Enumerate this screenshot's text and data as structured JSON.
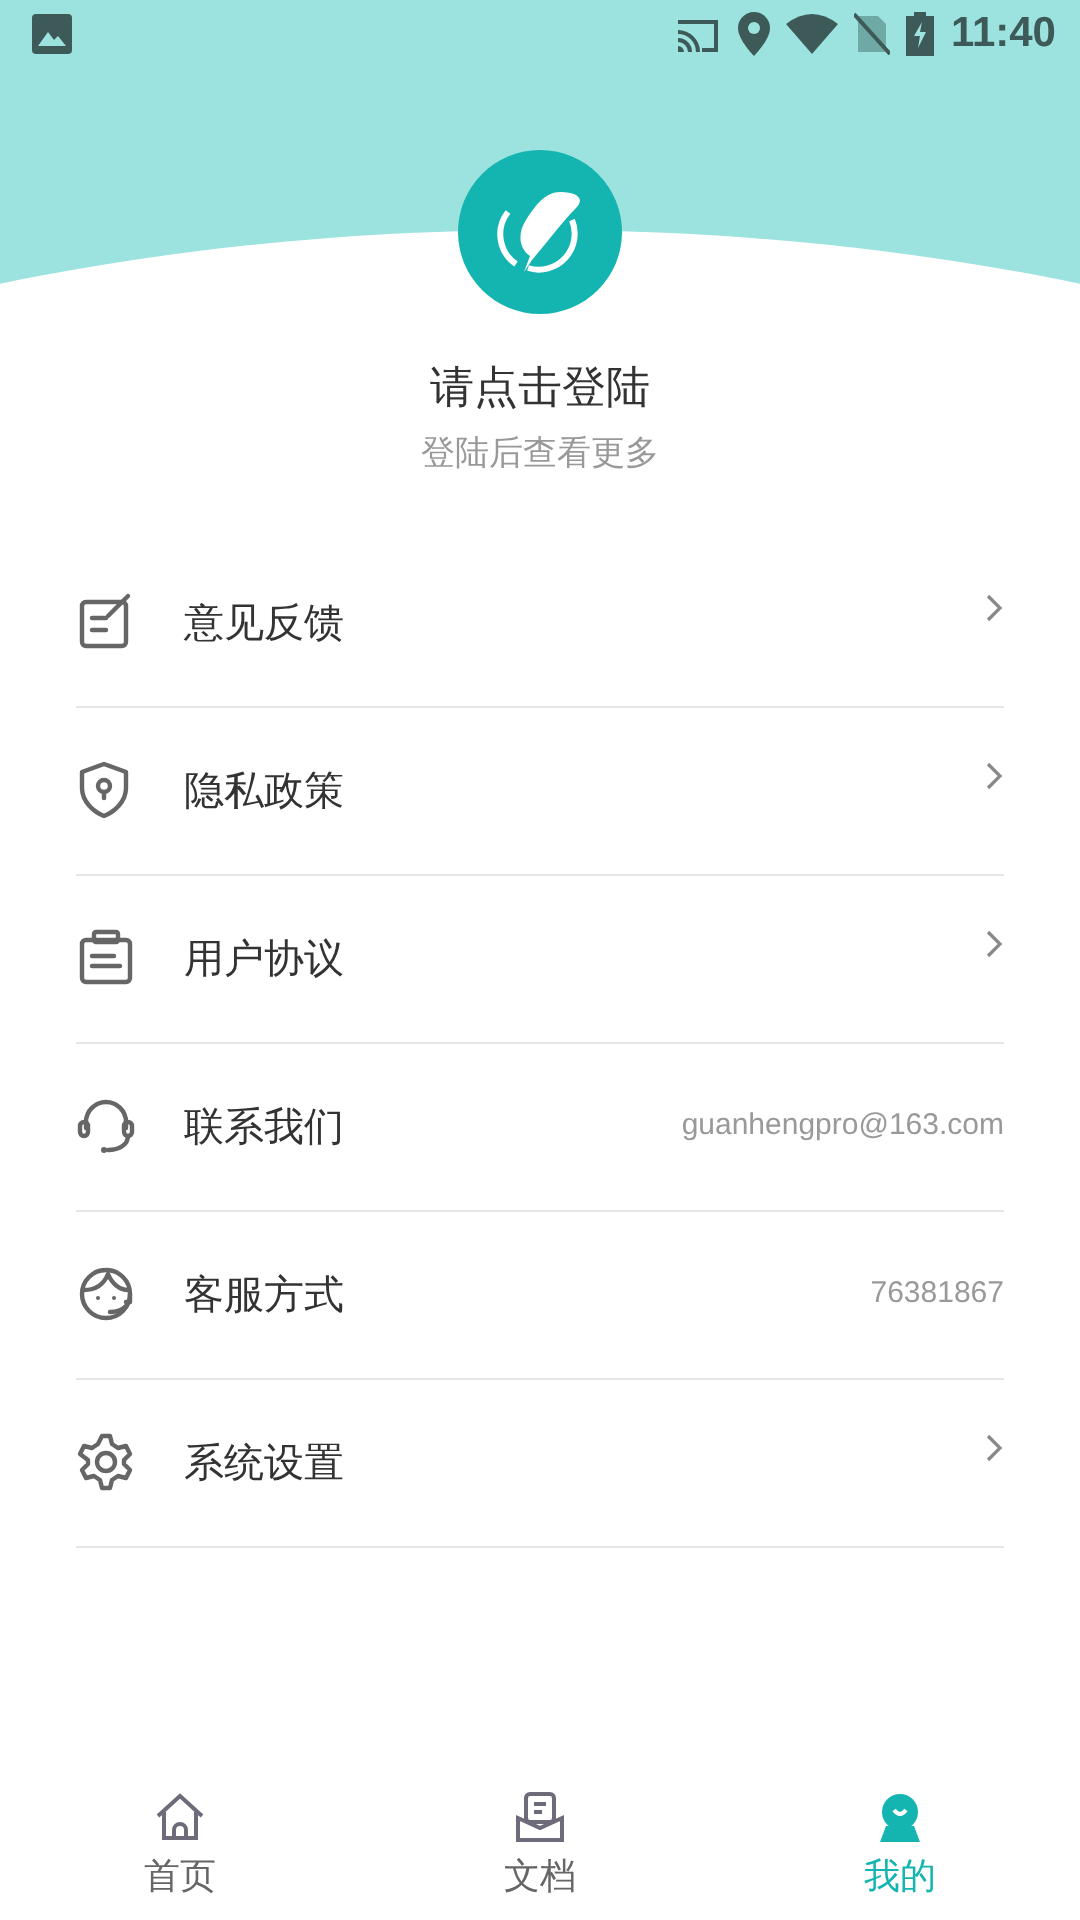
{
  "status_bar": {
    "time": "11:40"
  },
  "profile": {
    "title": "请点击登陆",
    "subtitle": "登陆后查看更多"
  },
  "menu": [
    {
      "kind": "link",
      "label": "意见反馈"
    },
    {
      "kind": "link",
      "label": "隐私政策"
    },
    {
      "kind": "link",
      "label": "用户协议"
    },
    {
      "kind": "info",
      "label": "联系我们",
      "value": "guanhengpro@163.com"
    },
    {
      "kind": "info",
      "label": "客服方式",
      "value": "76381867"
    },
    {
      "kind": "link",
      "label": "系统设置"
    }
  ],
  "bottom_nav": [
    {
      "label": "首页",
      "selected": false
    },
    {
      "label": "文档",
      "selected": false
    },
    {
      "label": "我的",
      "selected": true
    }
  ]
}
